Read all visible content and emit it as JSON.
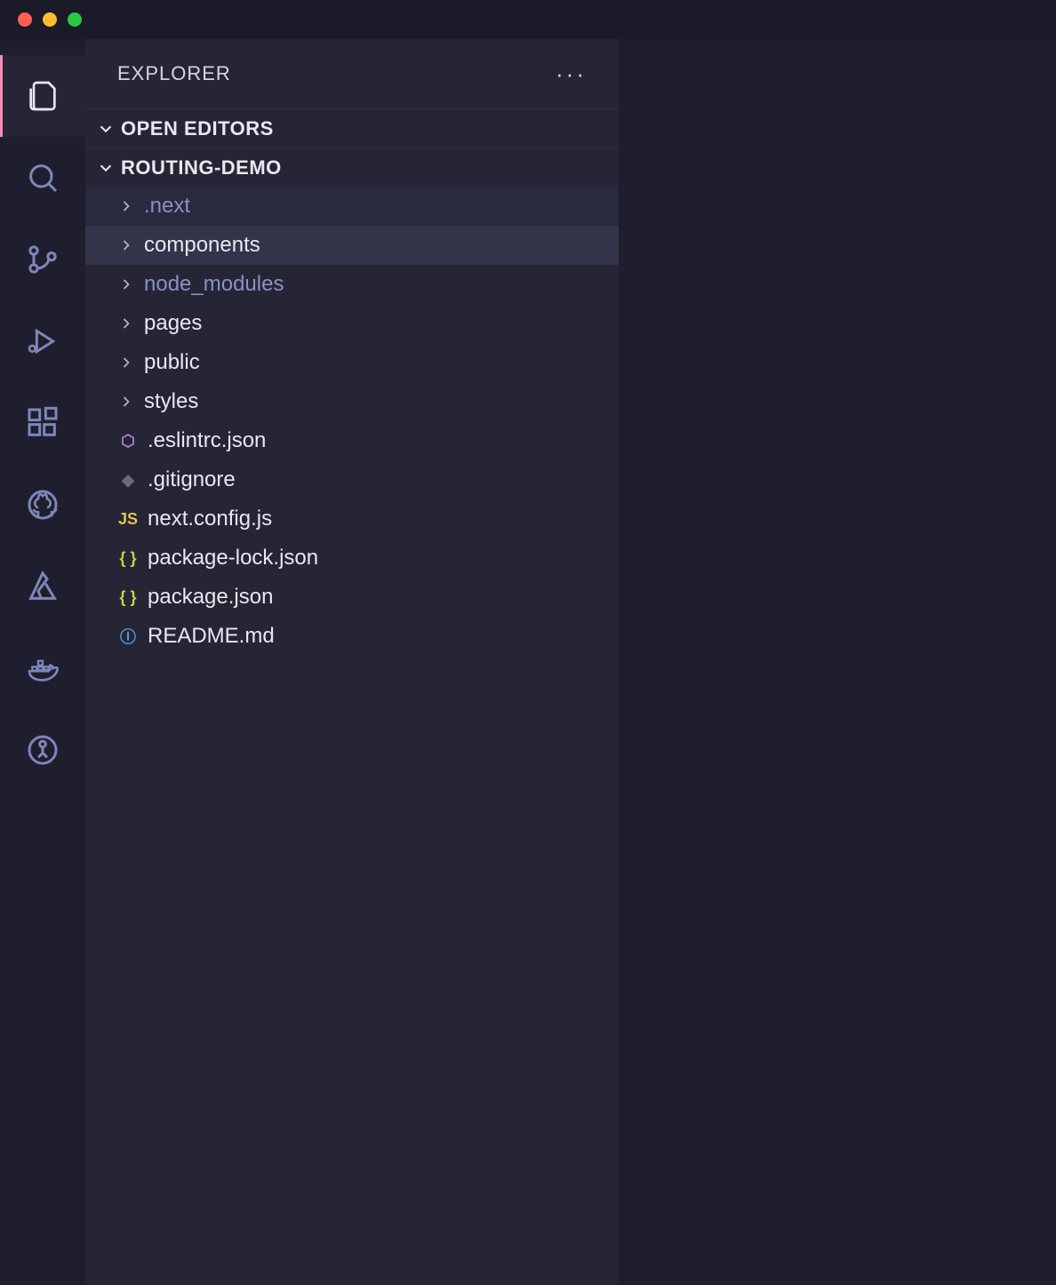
{
  "sidebar": {
    "title": "EXPLORER",
    "sections": {
      "openEditors": "OPEN EDITORS",
      "project": "ROUTING-DEMO"
    }
  },
  "tree": [
    {
      "name": ".next",
      "type": "folder",
      "dim": true,
      "rowStyle": "dim-row"
    },
    {
      "name": "components",
      "type": "folder",
      "dim": false,
      "rowStyle": "selected"
    },
    {
      "name": "node_modules",
      "type": "folder",
      "dim": true,
      "rowStyle": ""
    },
    {
      "name": "pages",
      "type": "folder",
      "dim": false,
      "rowStyle": ""
    },
    {
      "name": "public",
      "type": "folder",
      "dim": false,
      "rowStyle": ""
    },
    {
      "name": "styles",
      "type": "folder",
      "dim": false,
      "rowStyle": ""
    },
    {
      "name": ".eslintrc.json",
      "type": "file",
      "icon": "eslint",
      "glyph": "⬡"
    },
    {
      "name": ".gitignore",
      "type": "file",
      "icon": "git",
      "glyph": "◆"
    },
    {
      "name": "next.config.js",
      "type": "file",
      "icon": "js",
      "glyph": "JS"
    },
    {
      "name": "package-lock.json",
      "type": "file",
      "icon": "json",
      "glyph": "{ }"
    },
    {
      "name": "package.json",
      "type": "file",
      "icon": "json",
      "glyph": "{ }"
    },
    {
      "name": "README.md",
      "type": "file",
      "icon": "info",
      "glyph": "ⓘ"
    }
  ],
  "activity": [
    {
      "id": "explorer-icon",
      "active": true
    },
    {
      "id": "search-icon",
      "active": false
    },
    {
      "id": "source-control-icon",
      "active": false
    },
    {
      "id": "run-debug-icon",
      "active": false
    },
    {
      "id": "extensions-icon",
      "active": false
    },
    {
      "id": "github-icon",
      "active": false
    },
    {
      "id": "azure-icon",
      "active": false
    },
    {
      "id": "docker-icon",
      "active": false
    },
    {
      "id": "gitlens-icon",
      "active": false
    }
  ]
}
